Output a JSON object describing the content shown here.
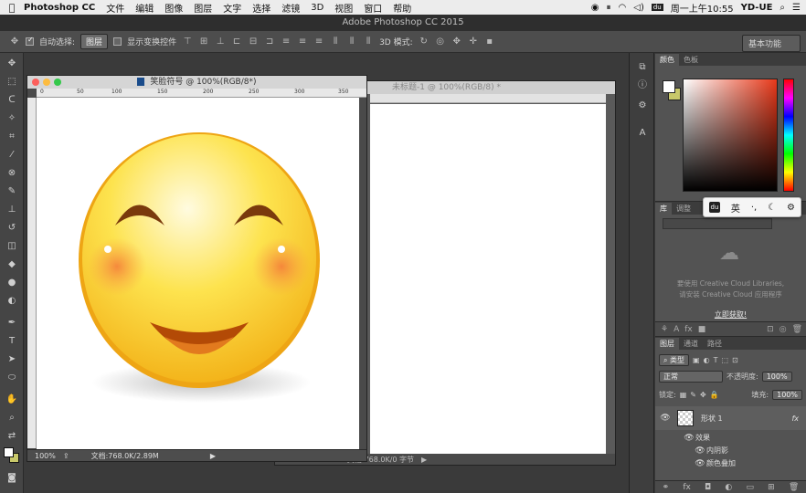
{
  "menubar": {
    "app_name": "Photoshop CC",
    "items": [
      "文件",
      "编辑",
      "图像",
      "图层",
      "文字",
      "选择",
      "滤镜",
      "3D",
      "视图",
      "窗口",
      "帮助"
    ],
    "clock": "周一上午10:55",
    "user": "YD-UE"
  },
  "window": {
    "title": "Adobe Photoshop CC 2015"
  },
  "options": {
    "auto_select_label": "自动选择:",
    "auto_select_value": "图层",
    "show_transform_label": "显示变换控件",
    "mode_3d_label": "3D 模式:",
    "workspace": "基本功能"
  },
  "doc1": {
    "title": "笑脸符号 @ 100%(RGB/8*)",
    "ruler_marks": [
      "0",
      "50",
      "100",
      "150",
      "200",
      "250",
      "300",
      "350"
    ],
    "zoom": "100%",
    "doc_info": "文档:768.0K/2.89M"
  },
  "doc2": {
    "title": "未标题-1 @ 100%(RGB/8) *",
    "zoom": "100%",
    "doc_info": "文档:768.0K/0 字节"
  },
  "color_panel": {
    "tabs": [
      "颜色",
      "色板"
    ],
    "fg_color": "#ffffff",
    "bg_color": "#c8c86a"
  },
  "library_panel": {
    "tabs": [
      "库",
      "调整"
    ],
    "line1": "要使用 Creative Cloud Libraries,",
    "line2": "请安装 Creative Cloud 应用程序",
    "link": "立即获取!"
  },
  "ime": {
    "lang": "英"
  },
  "layers_panel": {
    "tabs": [
      "图层",
      "通道",
      "路径"
    ],
    "filter_type": "类型",
    "blend_mode": "正常",
    "opacity_label": "不透明度:",
    "opacity": "100%",
    "lock_label": "锁定:",
    "fill_label": "填充:",
    "fill": "100%",
    "layer_name": "形状 1",
    "effects_label": "效果",
    "effects": [
      "内阴影",
      "颜色叠加"
    ]
  }
}
